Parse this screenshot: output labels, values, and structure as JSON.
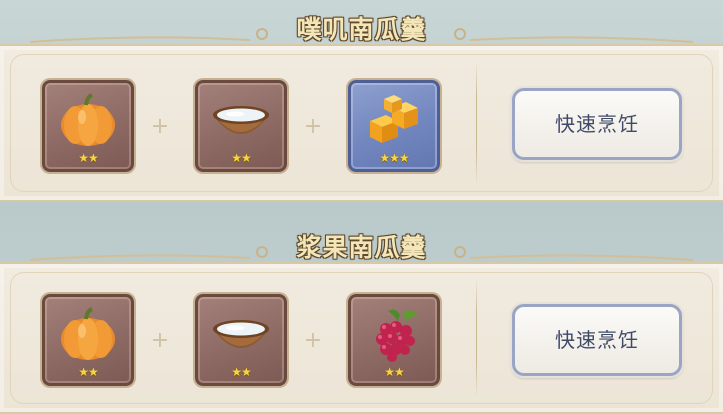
{
  "recipes": [
    {
      "title": "噗叽南瓜羹",
      "ingredients": [
        {
          "icon": "pumpkin-icon",
          "rarity": "★★",
          "frame": "brown"
        },
        {
          "icon": "coconut-milk-icon",
          "rarity": "★★",
          "frame": "brown"
        },
        {
          "icon": "honey-cube-icon",
          "rarity": "★★★",
          "frame": "blue"
        }
      ],
      "button_label": "快速烹饪"
    },
    {
      "title": "浆果南瓜羹",
      "ingredients": [
        {
          "icon": "pumpkin-icon",
          "rarity": "★★",
          "frame": "brown"
        },
        {
          "icon": "coconut-milk-icon",
          "rarity": "★★",
          "frame": "brown"
        },
        {
          "icon": "raspberry-icon",
          "rarity": "★★",
          "frame": "brown"
        }
      ],
      "button_label": "快速烹饪"
    }
  ],
  "plus_symbol": "+",
  "colors": {
    "title_text": "#f3e6b9",
    "panel_bg": "#ece5d6",
    "frame_brown": "#8e6a64",
    "frame_blue": "#7286bf",
    "star": "#f6d44a",
    "button_text": "#3f4a66"
  }
}
